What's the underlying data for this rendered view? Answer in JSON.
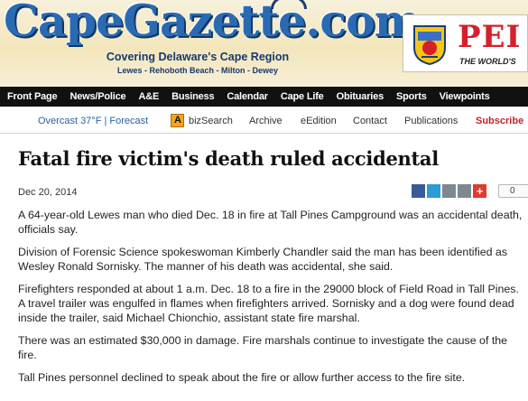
{
  "header": {
    "logo": "CapeGazette.com",
    "tagline": "Covering Delaware's Cape Region",
    "towns": "Lewes - Rehoboth Beach - Milton - Dewey"
  },
  "ad": {
    "big_text": "PEI",
    "small_text": "THE WORLD'S"
  },
  "main_nav": [
    "Front Page",
    "News/Police",
    "A&E",
    "Business",
    "Calendar",
    "Cape Life",
    "Obituaries",
    "Sports",
    "Viewpoints"
  ],
  "sub_nav": {
    "weather": "Overcast 37°F | Forecast",
    "bizsearch": "bizSearch",
    "archive": "Archive",
    "eedition": "eEdition",
    "contact": "Contact",
    "publications": "Publications",
    "subscribe": "Subscribe"
  },
  "article": {
    "headline": "Fatal fire victim's death ruled accidental",
    "date": "Dec 20, 2014",
    "share_count": "0",
    "paragraphs": [
      "A 64-year-old Lewes man who died Dec. 18 in fire at Tall Pines Campground was an accidental death, officials say.",
      "Division of Forensic Science spokeswoman Kimberly Chandler said the man has been identified as Wesley Ronald Sornisky. The manner of his death was accidental, she said.",
      "Firefighters responded at about 1 a.m. Dec. 18 to a fire in the 29000 block of Field Road in Tall Pines. A travel trailer was engulfed in flames when firefighters arrived. Sornisky and a dog were found dead inside the trailer, said Michael Chionchio, assistant state fire marshal.",
      "There was an estimated $30,000 in damage. Fire marshals continue to investigate the cause of the fire.",
      "Tall Pines personnel declined to speak about the fire or allow further access to the fire site."
    ]
  },
  "icons": {
    "share": [
      "facebook-icon",
      "twitter-icon",
      "email-icon",
      "print-icon",
      "add-icon"
    ],
    "bizsearch": "bizsearch-icon"
  },
  "colors": {
    "brand_blue": "#2a6ab3",
    "nav_bg": "#111111",
    "subscribe_red": "#c1252b"
  }
}
